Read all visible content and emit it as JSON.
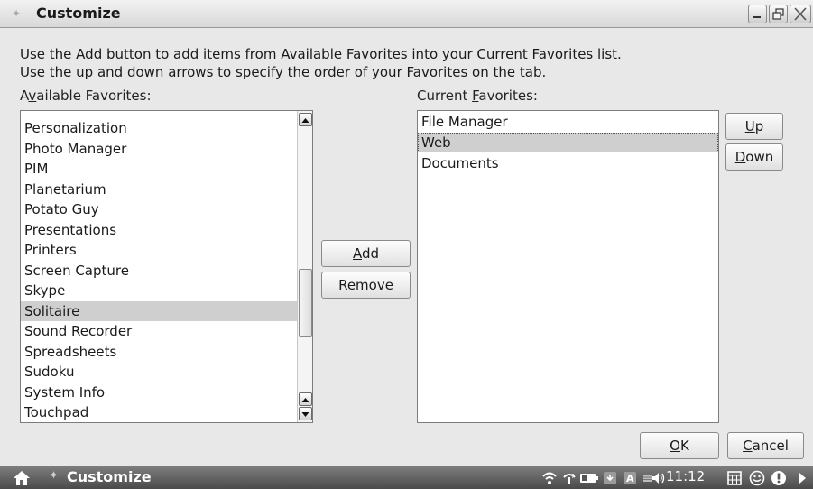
{
  "window": {
    "title": "Customize",
    "controls": {
      "minimize": "minimize",
      "maximize": "maximize",
      "close": "close"
    }
  },
  "instructions": {
    "line1": "Use the Add button to add items from Available Favorites into your Current Favorites list.",
    "line2": "Use the up and down arrows to specify the order of your Favorites on the tab."
  },
  "available": {
    "label_pre": "A",
    "label_mnemonic": "v",
    "label_post": "ailable Favorites:",
    "items": [
      "Personalization",
      "Photo Manager",
      "PIM",
      "Planetarium",
      "Potato Guy",
      "Presentations",
      "Printers",
      "Screen Capture",
      "Skype",
      "Solitaire",
      "Sound Recorder",
      "Spreadsheets",
      "Sudoku",
      "System Info",
      "Touchpad"
    ],
    "selected": "Solitaire"
  },
  "current": {
    "label_pre": "Current ",
    "label_mnemonic": "F",
    "label_post": "avorites:",
    "items": [
      "File Manager",
      "Web",
      "Documents"
    ],
    "selected": "Web"
  },
  "buttons": {
    "add_mnemonic": "A",
    "add_rest": "dd",
    "remove_mnemonic": "R",
    "remove_rest": "emove",
    "up_mnemonic": "U",
    "up_rest": "p",
    "down_mnemonic": "D",
    "down_rest": "own",
    "ok_mnemonic": "O",
    "ok_rest": "K",
    "cancel_mnemonic": "C",
    "cancel_rest": "ancel"
  },
  "taskbar": {
    "task_label": "Customize",
    "clock": "11:12"
  }
}
